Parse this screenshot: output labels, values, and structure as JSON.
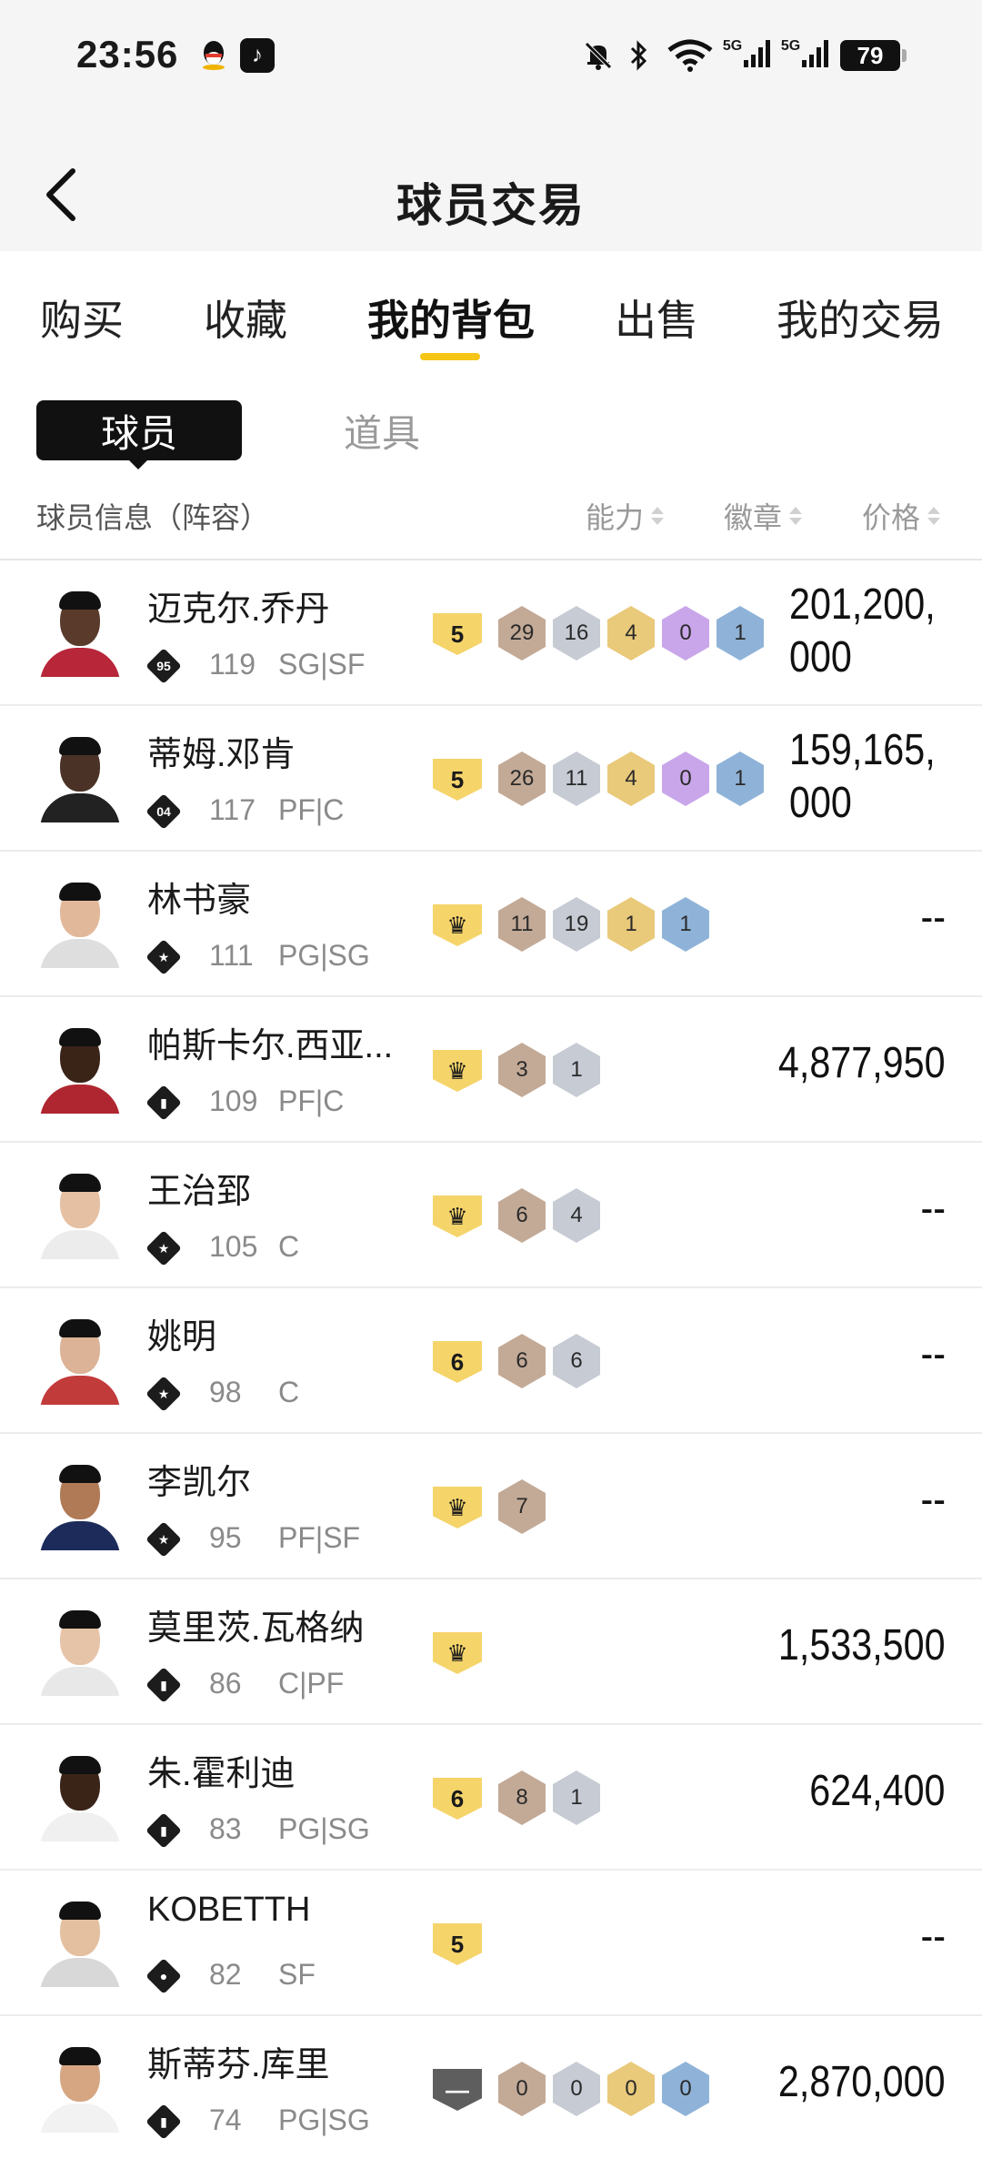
{
  "status_bar": {
    "time": "23:56",
    "battery": "79",
    "net1": "5G",
    "net2": "5G"
  },
  "header": {
    "title": "球员交易"
  },
  "tabs": [
    {
      "label": "购买"
    },
    {
      "label": "收藏"
    },
    {
      "label": "我的背包",
      "active": true
    },
    {
      "label": "出售"
    },
    {
      "label": "我的交易"
    }
  ],
  "subtabs": {
    "player": "球员",
    "item": "道具"
  },
  "columns": {
    "info": "球员信息（阵容）",
    "ability": "能力",
    "badge": "徽章",
    "price": "价格"
  },
  "colors": {
    "accent": "#f5c518"
  },
  "players": [
    {
      "name": "迈克尔.乔丹",
      "rank": "95",
      "rating": "119",
      "pos": "SG|SF",
      "medal": "5",
      "medal_type": "gold",
      "badges": [
        {
          "v": "29",
          "c": "brown"
        },
        {
          "v": "16",
          "c": "silver"
        },
        {
          "v": "4",
          "c": "gold"
        },
        {
          "v": "0",
          "c": "purple"
        },
        {
          "v": "1",
          "c": "blue"
        }
      ],
      "price": "201,200,000",
      "skin": "#5a3a2a",
      "jersey": "#b8263a"
    },
    {
      "name": "蒂姆.邓肯",
      "rank": "04",
      "rating": "117",
      "pos": "PF|C",
      "medal": "5",
      "medal_type": "gold",
      "badges": [
        {
          "v": "26",
          "c": "brown"
        },
        {
          "v": "11",
          "c": "silver"
        },
        {
          "v": "4",
          "c": "gold"
        },
        {
          "v": "0",
          "c": "purple"
        },
        {
          "v": "1",
          "c": "blue"
        }
      ],
      "price": "159,165,000",
      "skin": "#4a3226",
      "jersey": "#222222"
    },
    {
      "name": "林书豪",
      "rank": "★",
      "rating": "111",
      "pos": "PG|SG",
      "medal": "♛",
      "medal_type": "gold",
      "badges": [
        {
          "v": "11",
          "c": "brown"
        },
        {
          "v": "19",
          "c": "silver"
        },
        {
          "v": "1",
          "c": "gold"
        },
        {
          "v": "1",
          "c": "blue"
        }
      ],
      "price": "--",
      "skin": "#e2b89a",
      "jersey": "#dedede"
    },
    {
      "name": "帕斯卡尔.西亚...",
      "rank": "▮",
      "rating": "109",
      "pos": "PF|C",
      "medal": "♛",
      "medal_type": "gold",
      "badges": [
        {
          "v": "3",
          "c": "brown"
        },
        {
          "v": "1",
          "c": "silver"
        }
      ],
      "price": "4,877,950",
      "skin": "#3a2418",
      "jersey": "#b02630"
    },
    {
      "name": "王治郅",
      "rank": "★",
      "rating": "105",
      "pos": "C",
      "medal": "♛",
      "medal_type": "gold",
      "badges": [
        {
          "v": "6",
          "c": "brown"
        },
        {
          "v": "4",
          "c": "silver"
        }
      ],
      "price": "--",
      "skin": "#e6c0a2",
      "jersey": "#ececec"
    },
    {
      "name": "姚明",
      "rank": "★",
      "rating": "98",
      "pos": "C",
      "medal": "6",
      "medal_type": "gold",
      "badges": [
        {
          "v": "6",
          "c": "brown"
        },
        {
          "v": "6",
          "c": "silver"
        }
      ],
      "price": "--",
      "skin": "#dcb396",
      "jersey": "#c23b3b"
    },
    {
      "name": "李凯尔",
      "rank": "★",
      "rating": "95",
      "pos": "PF|SF",
      "medal": "♛",
      "medal_type": "gold",
      "badges": [
        {
          "v": "7",
          "c": "brown"
        }
      ],
      "price": "--",
      "skin": "#b07a56",
      "jersey": "#1c2b5a"
    },
    {
      "name": "莫里茨.瓦格纳",
      "rank": "▮",
      "rating": "86",
      "pos": "C|PF",
      "medal": "♛",
      "medal_type": "gold",
      "badges": [],
      "price": "1,533,500",
      "skin": "#e6c4a8",
      "jersey": "#e8e8e8"
    },
    {
      "name": "朱.霍利迪",
      "rank": "▮",
      "rating": "83",
      "pos": "PG|SG",
      "medal": "6",
      "medal_type": "gold",
      "badges": [
        {
          "v": "8",
          "c": "brown"
        },
        {
          "v": "1",
          "c": "silver"
        }
      ],
      "price": "624,400",
      "skin": "#3a2418",
      "jersey": "#f0f0f0"
    },
    {
      "name": "KOBETTH",
      "rank": "●",
      "rating": "82",
      "pos": "SF",
      "medal": "5",
      "medal_type": "gold",
      "badges": [],
      "price": "--",
      "skin": "#e4c0a0",
      "jersey": "#d8d8d8"
    },
    {
      "name": "斯蒂芬.库里",
      "rank": "▮",
      "rating": "74",
      "pos": "PG|SG",
      "medal": "—",
      "medal_type": "grey",
      "badges": [
        {
          "v": "0",
          "c": "brown"
        },
        {
          "v": "0",
          "c": "silver"
        },
        {
          "v": "0",
          "c": "gold"
        },
        {
          "v": "0",
          "c": "blue"
        }
      ],
      "price": "2,870,000",
      "skin": "#d6a682",
      "jersey": "#f2f2f2"
    }
  ]
}
